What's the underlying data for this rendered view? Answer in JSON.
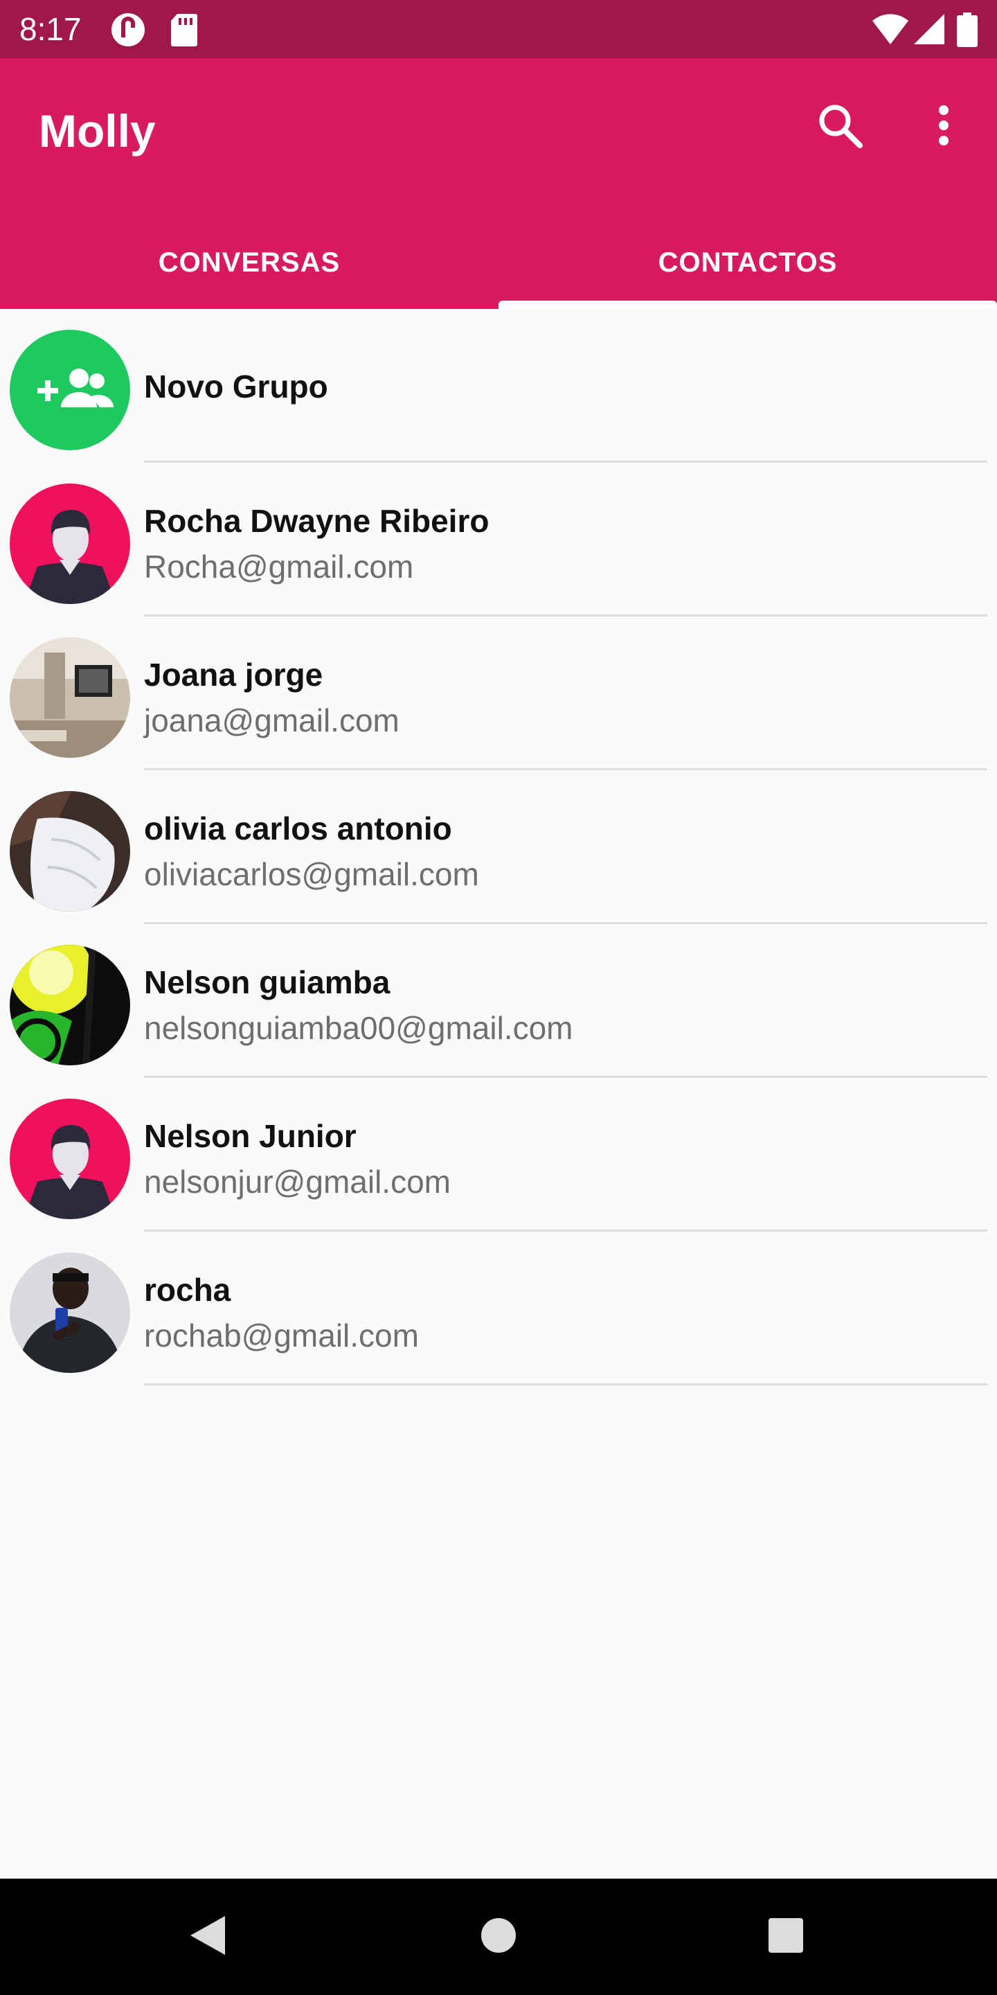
{
  "status_bar": {
    "time": "8:17",
    "icons": [
      "notification-app-icon",
      "sd-card-icon",
      "wifi-icon",
      "cell-signal-icon",
      "battery-icon"
    ]
  },
  "app_bar": {
    "title": "Molly",
    "actions": [
      "search-icon",
      "more-vert-icon"
    ],
    "colors": {
      "primary": "#d81b60",
      "primary_dark": "#a0174b"
    }
  },
  "tabs": [
    {
      "label": "CONVERSAS",
      "selected": false
    },
    {
      "label": "CONTACTOS",
      "selected": true
    }
  ],
  "contacts": {
    "new_group": {
      "label": "Novo Grupo",
      "icon": "group-add-icon",
      "color": "#1ec95f"
    },
    "items": [
      {
        "name": "Rocha Dwayne Ribeiro",
        "email": "Rocha@gmail.com",
        "avatar": "default-avatar"
      },
      {
        "name": "Joana jorge",
        "email": "joana@gmail.com",
        "avatar": "photo-room"
      },
      {
        "name": "olivia carlos antonio",
        "email": "oliviacarlos@gmail.com",
        "avatar": "photo-towel"
      },
      {
        "name": "Nelson guiamba",
        "email": "nelsonguiamba00@gmail.com",
        "avatar": "photo-green"
      },
      {
        "name": "Nelson Junior",
        "email": "nelsonjur@gmail.com",
        "avatar": "default-avatar"
      },
      {
        "name": "rocha",
        "email": "rochab@gmail.com",
        "avatar": "photo-selfie"
      }
    ]
  },
  "nav_bar": {
    "buttons": [
      "back-icon",
      "home-icon",
      "recents-icon"
    ]
  }
}
